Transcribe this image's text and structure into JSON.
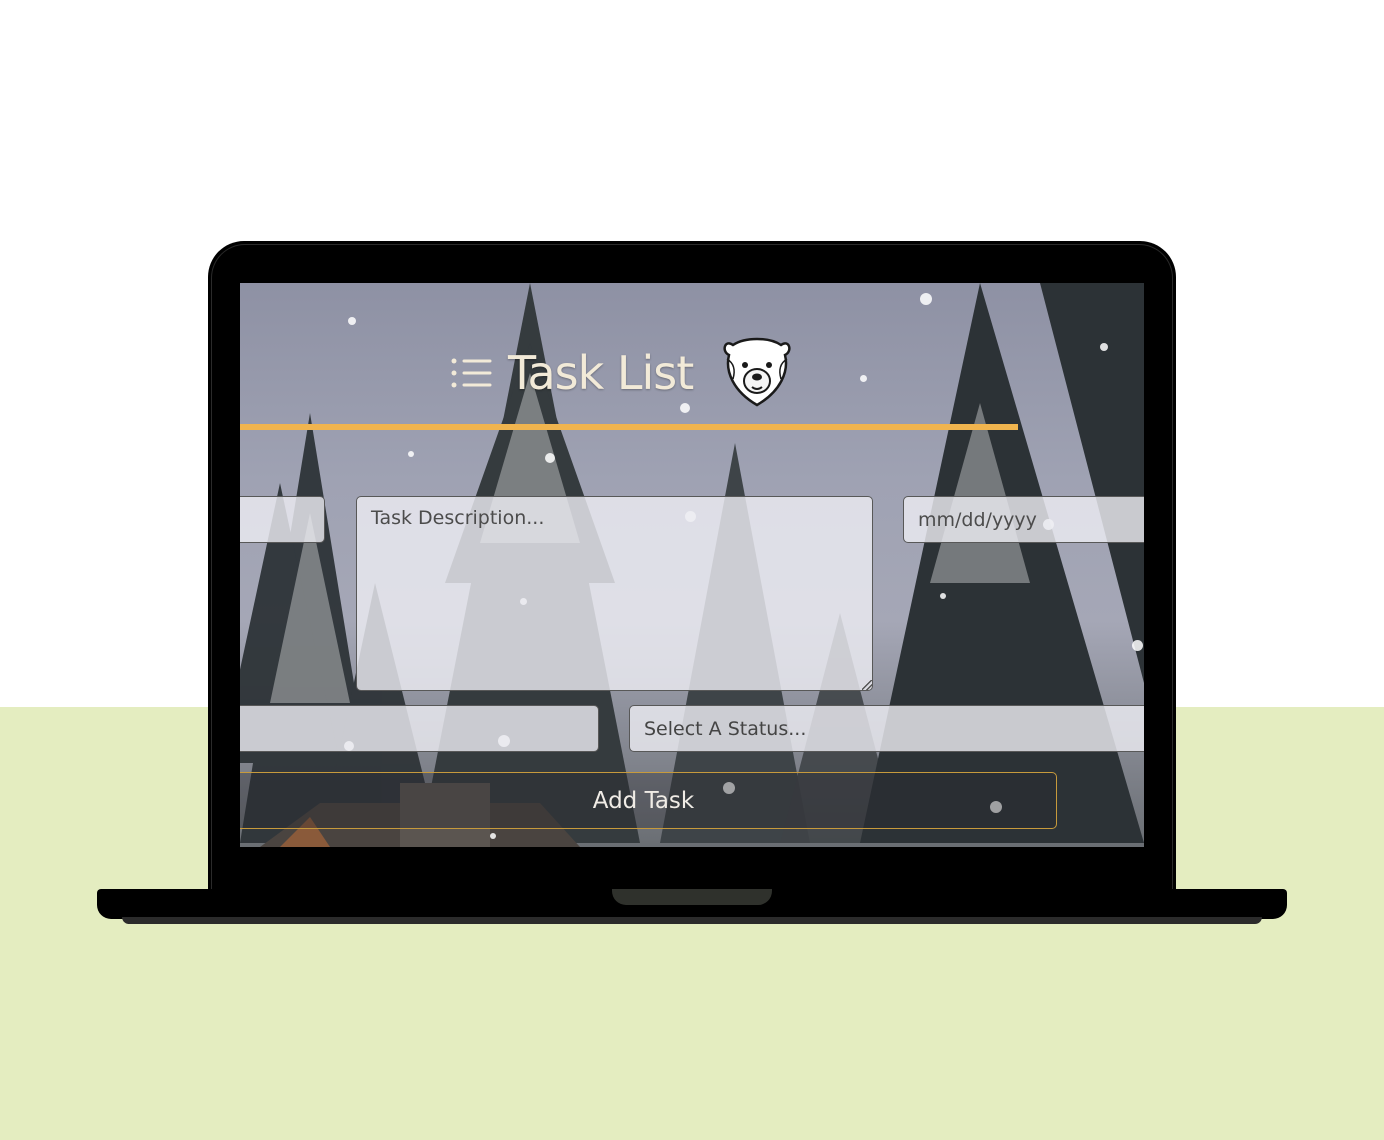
{
  "app": {
    "title": "Task List",
    "accent_color": "#f0b44e",
    "icons": {
      "title_left": "list-icon",
      "title_right": "polar-bear-icon"
    }
  },
  "form": {
    "name_placeholder": "",
    "description_placeholder": "Task Description...",
    "date_placeholder": "mm/dd/yyyy",
    "assignee_placeholder": "",
    "status_placeholder": "Select A Status...",
    "submit_label": "Add Task"
  },
  "scene": {
    "background_color_top": "#ffffff",
    "background_color_bottom": "#e4edc0",
    "device": "laptop"
  }
}
